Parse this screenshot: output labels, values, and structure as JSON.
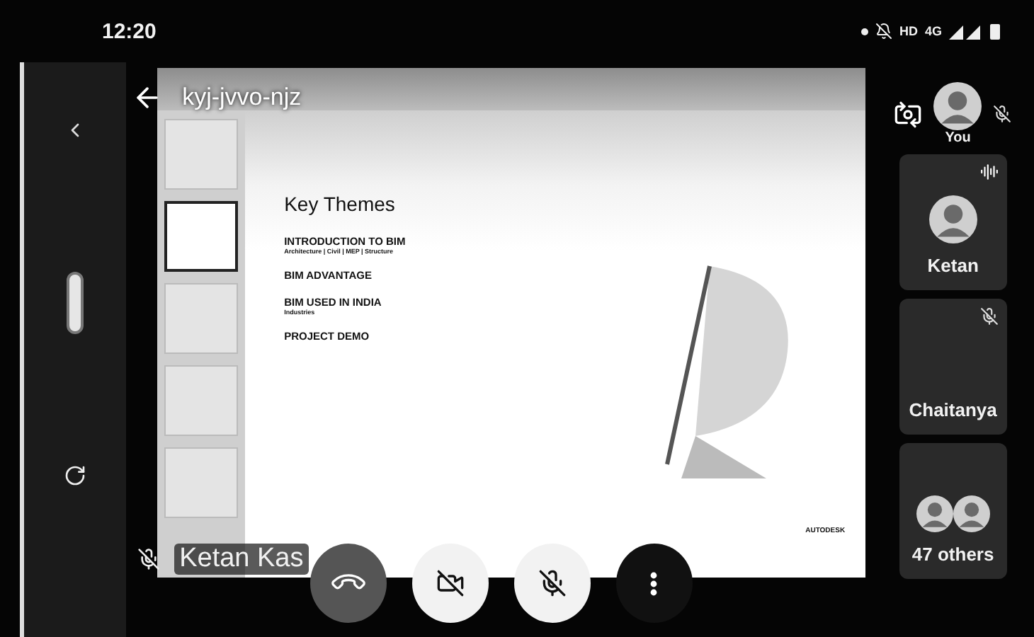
{
  "status_bar": {
    "time": "12:20",
    "indicators": [
      "HD",
      "4G"
    ]
  },
  "meeting": {
    "code": "kyj-jvvo-njz"
  },
  "shared_screen": {
    "thumbnails": [
      {
        "selected": false
      },
      {
        "selected": true
      },
      {
        "selected": false
      },
      {
        "selected": false
      },
      {
        "selected": false
      }
    ],
    "slide": {
      "title": "Key Themes",
      "items": [
        {
          "heading": "INTRODUCTION TO BIM",
          "note": "Architecture | Civil | MEP | Structure"
        },
        {
          "heading": "BIM ADVANTAGE"
        },
        {
          "heading": "BIM USED IN INDIA",
          "note": "Industries"
        },
        {
          "heading": "PROJECT DEMO"
        }
      ],
      "logo": "AUTODESK"
    }
  },
  "presenter": {
    "name": "Ketan Kas",
    "muted": true
  },
  "self": {
    "label": "You",
    "muted": true
  },
  "participants": [
    {
      "name": "Ketan",
      "muted": false,
      "speaking": true,
      "avatar": true
    },
    {
      "name": "Chaitanya",
      "muted": true,
      "speaking": false,
      "avatar": false
    }
  ],
  "others": {
    "label": "47 others"
  },
  "controls": [
    {
      "kind": "hangup"
    },
    {
      "kind": "camera"
    },
    {
      "kind": "mic"
    },
    {
      "kind": "more"
    }
  ]
}
